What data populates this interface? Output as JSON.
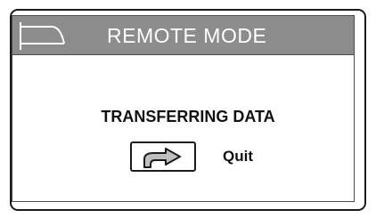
{
  "header": {
    "icon": "mode-screen-icon",
    "title": "REMOTE MODE"
  },
  "main": {
    "status_message": "TRANSFERRING DATA",
    "quit_icon": "redo-arrow-icon",
    "quit_label": "Quit"
  },
  "colors": {
    "title_bar": "#8c8c8c",
    "title_text": "#ffffff",
    "border": "#1a1a1a"
  }
}
